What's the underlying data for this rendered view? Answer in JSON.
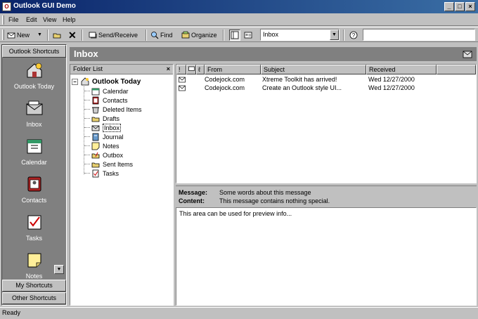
{
  "window": {
    "title": "Outlook GUI Demo"
  },
  "menu": [
    {
      "label": "File"
    },
    {
      "label": "Edit"
    },
    {
      "label": "View"
    },
    {
      "label": "Help"
    }
  ],
  "toolbar": {
    "new_label": "New",
    "send_receive_label": "Send/Receive",
    "find_label": "Find",
    "organize_label": "Organize",
    "folder_combo_value": "Inbox"
  },
  "outlook_bar": {
    "header": "Outlook Shortcuts",
    "items": [
      {
        "label": "Outlook Today",
        "icon": "outlook-today-icon"
      },
      {
        "label": "Inbox",
        "icon": "inbox-icon"
      },
      {
        "label": "Calendar",
        "icon": "calendar-icon"
      },
      {
        "label": "Contacts",
        "icon": "contacts-icon"
      },
      {
        "label": "Tasks",
        "icon": "tasks-icon"
      },
      {
        "label": "Notes",
        "icon": "notes-icon"
      }
    ],
    "footer_groups": [
      {
        "label": "My Shortcuts"
      },
      {
        "label": "Other Shortcuts"
      }
    ]
  },
  "view_header": {
    "title": "Inbox"
  },
  "folder_list": {
    "header": "Folder List",
    "root": "Outlook Today",
    "items": [
      {
        "label": "Calendar"
      },
      {
        "label": "Contacts"
      },
      {
        "label": "Deleted Items"
      },
      {
        "label": "Drafts"
      },
      {
        "label": "Inbox"
      },
      {
        "label": "Journal"
      },
      {
        "label": "Notes"
      },
      {
        "label": "Outbox"
      },
      {
        "label": "Sent Items"
      },
      {
        "label": "Tasks"
      }
    ],
    "selected": "Inbox"
  },
  "message_list": {
    "columns": {
      "from": "From",
      "subject": "Subject",
      "received": "Received"
    },
    "rows": [
      {
        "from": "Codejock.com",
        "subject": "Xtreme Toolkit has arrived!",
        "received": "Wed 12/27/2000"
      },
      {
        "from": "Codejock.com",
        "subject": "Create an Outlook style UI...",
        "received": "Wed 12/27/2000"
      }
    ]
  },
  "preview": {
    "message_label": "Message:",
    "message_value": "Some words about this message",
    "content_label": "Content:",
    "content_value": "This message contains nothing special.",
    "body": "This area can be used for preview info..."
  },
  "status": {
    "text": "Ready"
  },
  "colors": {
    "title_gradient_start": "#0a246a",
    "title_gradient_end": "#3a6ea5",
    "face": "#c0c0c0",
    "outlook_bar_bg": "#808080"
  }
}
